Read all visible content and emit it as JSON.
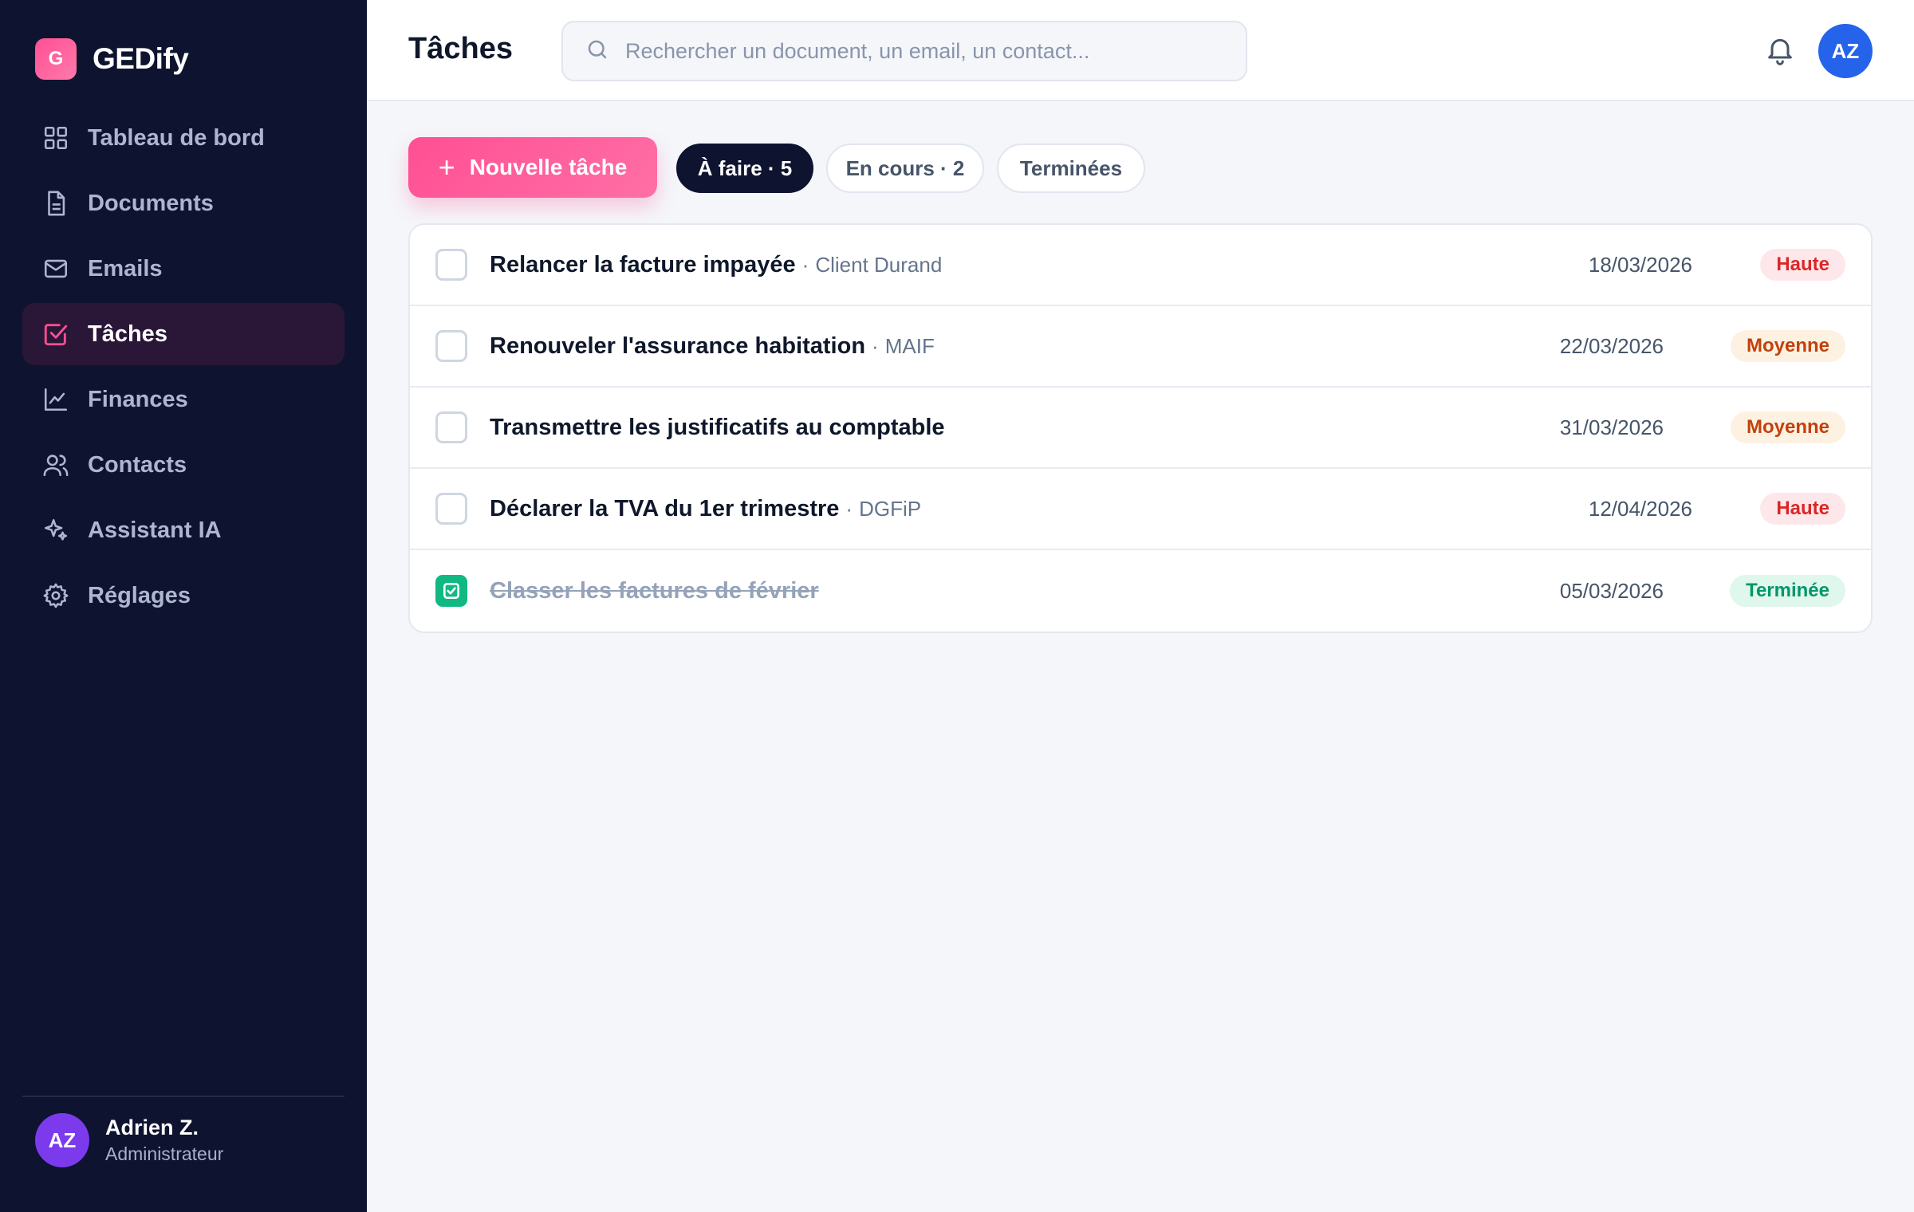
{
  "brand": {
    "logo_letter": "G",
    "name": "GEDify"
  },
  "sidebar": {
    "items": [
      {
        "label": "Tableau de bord",
        "icon": "dashboard-grid-icon",
        "active": false
      },
      {
        "label": "Documents",
        "icon": "document-icon",
        "active": false
      },
      {
        "label": "Emails",
        "icon": "mail-icon",
        "active": false
      },
      {
        "label": "Tâches",
        "icon": "task-check-icon",
        "active": true
      },
      {
        "label": "Finances",
        "icon": "chart-line-icon",
        "active": false
      },
      {
        "label": "Contacts",
        "icon": "users-icon",
        "active": false
      },
      {
        "label": "Assistant IA",
        "icon": "sparkles-icon",
        "active": false
      },
      {
        "label": "Réglages",
        "icon": "gear-icon",
        "active": false
      }
    ]
  },
  "user": {
    "initials": "AZ",
    "name": "Adrien Z.",
    "role": "Administrateur"
  },
  "header": {
    "title": "Tâches",
    "search_placeholder": "Rechercher un document, un email, un contact...",
    "avatar_initials": "AZ"
  },
  "toolbar": {
    "new_task_label": "Nouvelle tâche",
    "filters": [
      {
        "label": "À faire · 5",
        "active": true
      },
      {
        "label": "En cours · 2",
        "active": false
      },
      {
        "label": "Terminées",
        "active": false
      }
    ]
  },
  "tasks": [
    {
      "title": "Relancer la facture impayée",
      "separator": "·",
      "contact": "Client Durand",
      "date": "18/03/2026",
      "priority": "Haute",
      "done": false
    },
    {
      "title": "Renouveler l'assurance habitation",
      "separator": "·",
      "contact": "MAIF",
      "date": "22/03/2026",
      "priority": "Moyenne",
      "done": false
    },
    {
      "title": "Transmettre les justificatifs au comptable",
      "separator": "",
      "contact": "",
      "date": "31/03/2026",
      "priority": "Moyenne",
      "done": false
    },
    {
      "title": "Déclarer la TVA du 1er trimestre",
      "separator": "·",
      "contact": "DGFiP",
      "date": "12/04/2026",
      "priority": "Haute",
      "done": false
    },
    {
      "title": "Classer les factures de février",
      "separator": "",
      "contact": "",
      "date": "05/03/2026",
      "priority": "Terminée",
      "done": true
    }
  ],
  "colors": {
    "sidebar_bg": "#0e1330",
    "accent_pink": "#ff4f93",
    "active_nav_bg": "#2a1738",
    "priority_high": "#dc2626",
    "priority_medium": "#c2410c",
    "status_done": "#059669",
    "header_avatar": "#2563eb",
    "user_avatar": "#7c3aed"
  }
}
